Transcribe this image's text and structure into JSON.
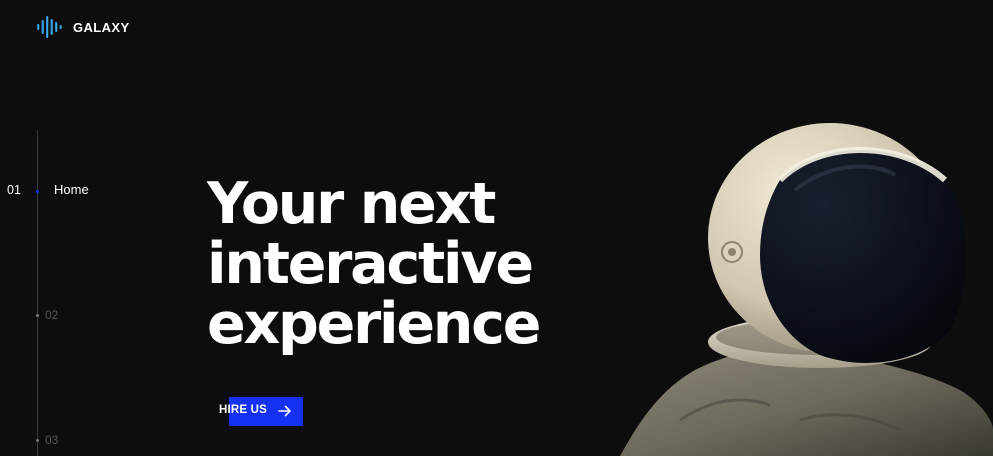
{
  "brand": {
    "name": "GALAXY",
    "icon": "sound-wave-logo-icon",
    "accent": "#3fa9f5"
  },
  "side_nav": {
    "items": [
      {
        "number": "01",
        "label": "Home",
        "active": true
      },
      {
        "number": "02",
        "label": "",
        "active": false
      },
      {
        "number": "03",
        "label": "",
        "active": false
      }
    ]
  },
  "hero": {
    "headline_lines": [
      "Your next",
      "interactive",
      "experience"
    ],
    "cta_label": "HIRE US",
    "cta_icon": "arrow-right-icon",
    "cta_color": "#1431f5"
  },
  "image": {
    "subject": "astronaut-helmet-image"
  }
}
